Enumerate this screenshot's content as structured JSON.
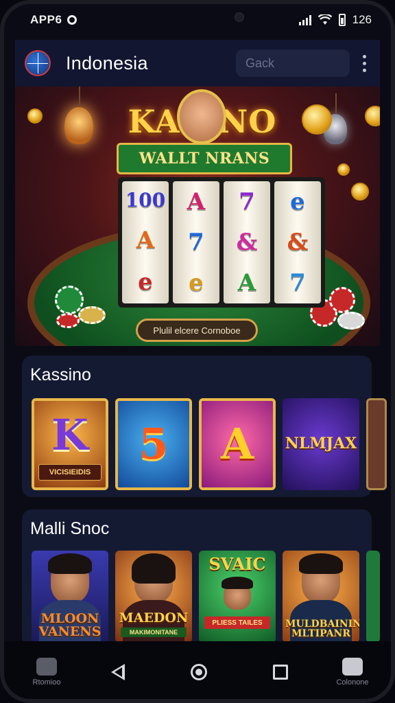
{
  "status_bar": {
    "left_text": "APP6",
    "time": "126"
  },
  "app_bar": {
    "title": "Indonesia",
    "search_placeholder": "Gack"
  },
  "hero": {
    "title": "KASINO",
    "subtitle": "WALLT NRANS",
    "reel_symbols": [
      [
        "100",
        "A",
        "e"
      ],
      [
        "A",
        "7",
        "e"
      ],
      [
        "7",
        "&",
        "A"
      ],
      [
        "e",
        "&",
        "7"
      ]
    ],
    "button_label": "Plulil elcere Cornoboe"
  },
  "sections": [
    {
      "title": "Kassino",
      "tiles": [
        {
          "label": "K",
          "caption": "VICISIEIDIS"
        },
        {
          "label": "5",
          "caption": ""
        },
        {
          "label": "A",
          "caption": ""
        },
        {
          "label": "NLMJAX",
          "caption": ""
        }
      ]
    },
    {
      "title": "Malli Snoc",
      "tiles": [
        {
          "caption": "MLOON VANENS",
          "sub": ""
        },
        {
          "caption": "MAEDON",
          "sub": "MAKIMONITANE"
        },
        {
          "caption": "SVAIC",
          "sub": "PLIESS TAILES"
        },
        {
          "caption": "MULDBAININ MLTIPANR",
          "sub": ""
        }
      ]
    }
  ],
  "nav_bar": {
    "left_label": "Rtomioo",
    "right_label": "Colonone"
  },
  "colors": {
    "app_bar_bg": "#121631",
    "section_bg": "#151a33",
    "gold": "#ffd24a"
  }
}
